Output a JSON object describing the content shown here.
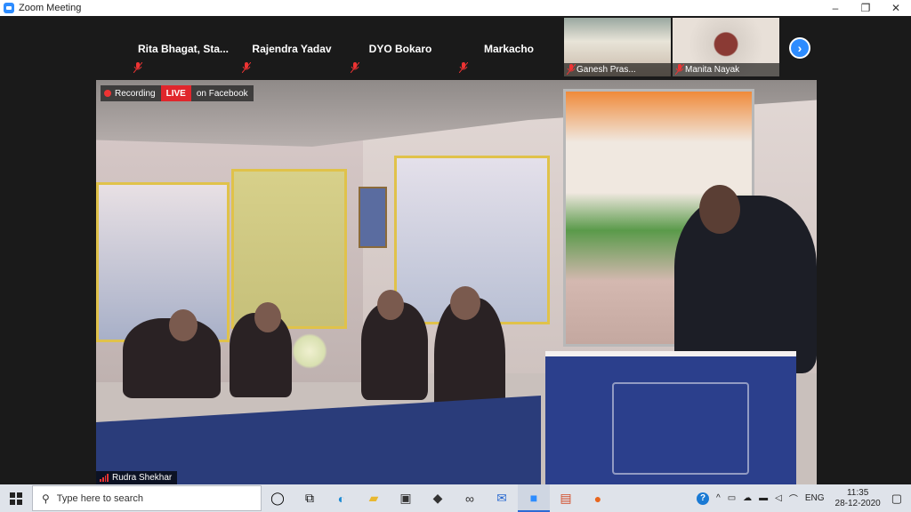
{
  "window": {
    "title": "Zoom Meeting",
    "controls": [
      "–",
      "❐",
      "✕"
    ]
  },
  "participants": [
    {
      "name": "Rita Bhagat, Sta...",
      "video": false
    },
    {
      "name": "Rajendra Yadav",
      "video": false
    },
    {
      "name": "DYO Bokaro",
      "video": false
    },
    {
      "name": "Markacho",
      "video": false
    },
    {
      "name": "Ganesh Pras...",
      "video": true
    },
    {
      "name": "Manita Nayak",
      "video": true
    }
  ],
  "recording": {
    "recording_label": "Recording",
    "live_label": "LIVE",
    "platform_label": "on Facebook"
  },
  "active_speaker": {
    "name": "Rudra Shekhar"
  },
  "taskbar": {
    "search_placeholder": "Type here to search",
    "language": "ENG",
    "time": "11:35",
    "date": "28-12-2020"
  },
  "colors": {
    "accent": "#2d8cff",
    "live": "#e0262c"
  }
}
